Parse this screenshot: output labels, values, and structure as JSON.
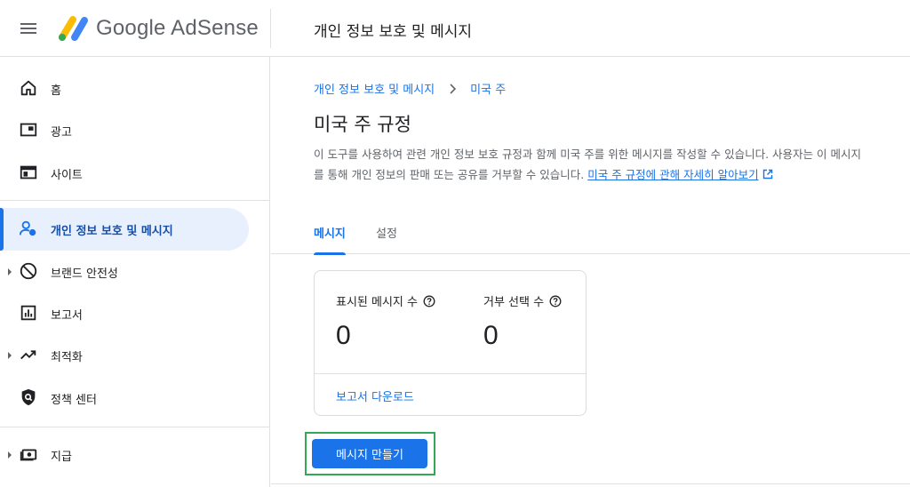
{
  "header": {
    "brand": "Google AdSense",
    "page_title": "개인 정보 보호 및 메시지"
  },
  "sidebar": {
    "items": [
      {
        "label": "홈",
        "icon": "home-icon"
      },
      {
        "label": "광고",
        "icon": "ads-icon"
      },
      {
        "label": "사이트",
        "icon": "sites-icon"
      },
      {
        "label": "개인 정보 보호 및 메시지",
        "icon": "privacy-icon",
        "active": true
      },
      {
        "label": "브랜드 안전성",
        "icon": "block-icon"
      },
      {
        "label": "보고서",
        "icon": "reports-icon"
      },
      {
        "label": "최적화",
        "icon": "trending-up-icon"
      },
      {
        "label": "정책 센터",
        "icon": "policy-shield-icon"
      },
      {
        "label": "지급",
        "icon": "payments-icon"
      }
    ]
  },
  "breadcrumb": {
    "parent": "개인 정보 보호 및 메시지",
    "current": "미국 주"
  },
  "main": {
    "title": "미국 주 규정",
    "description": "이 도구를 사용하여 관련 개인 정보 보호 규정과 함께 미국 주를 위한 메시지를 작성할 수 있습니다. 사용자는 이 메시지를 통해 개인 정보의 판매 또는 공유를 거부할 수 있습니다. ",
    "learn_more": "미국 주 규정에 관해 자세히 알아보기"
  },
  "tabs": [
    {
      "label": "메시지",
      "active": true
    },
    {
      "label": "설정",
      "active": false
    }
  ],
  "stats": {
    "shown_label": "표시된 메시지 수",
    "shown_value": "0",
    "optout_label": "거부 선택 수",
    "optout_value": "0",
    "download_label": "보고서 다운로드"
  },
  "actions": {
    "create_label": "메시지 만들기"
  },
  "colors": {
    "accent": "#1a73e8",
    "active_bg": "#e8f0fe",
    "highlight": "#34a853"
  }
}
